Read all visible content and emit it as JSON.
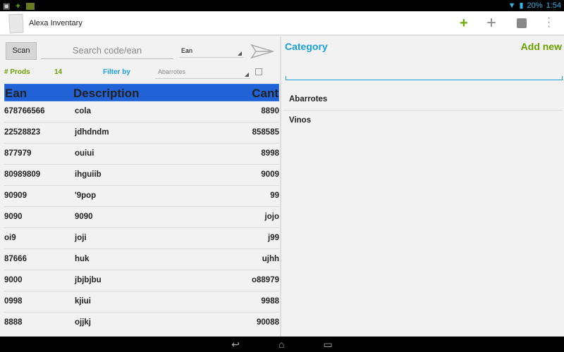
{
  "status": {
    "battery": "20%",
    "time": "1:54"
  },
  "app": {
    "title": "Alexa Inventary"
  },
  "toolbar": {
    "scan_label": "Scan",
    "search_placeholder": "Search code/ean",
    "search_type": "Ean"
  },
  "filter": {
    "prods_label": "# Prods",
    "prods_count": "14",
    "filter_label": "Filter by",
    "filter_value": "Abarrotes"
  },
  "table": {
    "headers": [
      "Ean",
      "Description",
      "Cant"
    ],
    "rows": [
      [
        "678766566",
        "cola",
        "8890"
      ],
      [
        "22528823",
        "jdhdndm",
        "858585"
      ],
      [
        "877979",
        "ouiui",
        "8998"
      ],
      [
        "80989809",
        "ihguiib",
        "9009"
      ],
      [
        "90909",
        "'9pop",
        "99"
      ],
      [
        "9090",
        "9090",
        "jojo"
      ],
      [
        "oi9",
        "joji",
        "j99"
      ],
      [
        "87666",
        "huk",
        "ujhh"
      ],
      [
        "9000",
        "jbjbjbu",
        "o88979"
      ],
      [
        "0998",
        "kjiui",
        "9988"
      ],
      [
        "8888",
        "ojjkj",
        "90088"
      ]
    ]
  },
  "category": {
    "title": "Category",
    "add_new": "Add new",
    "items": [
      "Abarrotes",
      "Vinos"
    ]
  },
  "colors": {
    "accent_blue": "#1a9fd6",
    "green": "#6a9f00",
    "header_blue": "#2163d6"
  }
}
